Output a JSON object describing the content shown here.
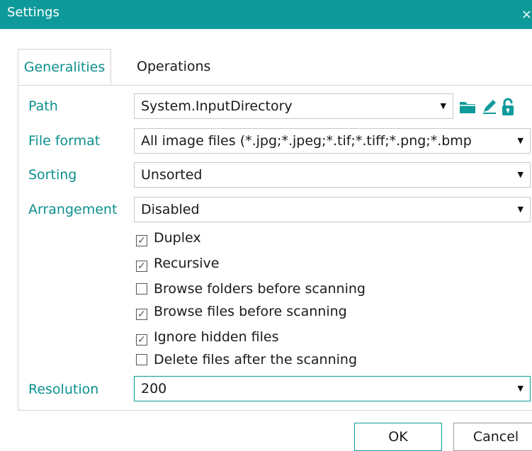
{
  "window": {
    "title": "Settings",
    "close_glyph": "×"
  },
  "tabs": [
    {
      "label": "Generalities",
      "active": true
    },
    {
      "label": "Operations",
      "active": false
    }
  ],
  "form": {
    "path": {
      "label": "Path",
      "value": "System.InputDirectory"
    },
    "file_format": {
      "label": "File format",
      "value": "All image files (*.jpg;*.jpeg;*.tif;*.tiff;*.png;*.bmp"
    },
    "sorting": {
      "label": "Sorting",
      "value": "Unsorted"
    },
    "arrangement": {
      "label": "Arrangement",
      "value": "Disabled"
    },
    "resolution": {
      "label": "Resolution",
      "value": "200"
    }
  },
  "checkboxes": [
    {
      "label": "Duplex",
      "checked": true
    },
    {
      "label": "Recursive",
      "checked": true
    },
    {
      "label": "Browse folders before scanning",
      "checked": false
    },
    {
      "label": "Browse files before scanning",
      "checked": true
    },
    {
      "label": "Ignore hidden files",
      "checked": true
    },
    {
      "label": "Delete files after the scanning",
      "checked": false
    }
  ],
  "buttons": {
    "ok": "OK",
    "cancel": "Cancel"
  },
  "icons": [
    "folder-icon",
    "pencil-icon",
    "unlock-icon"
  ],
  "colors": {
    "accent": "#0e9a9a",
    "label": "#0e8f8f"
  }
}
